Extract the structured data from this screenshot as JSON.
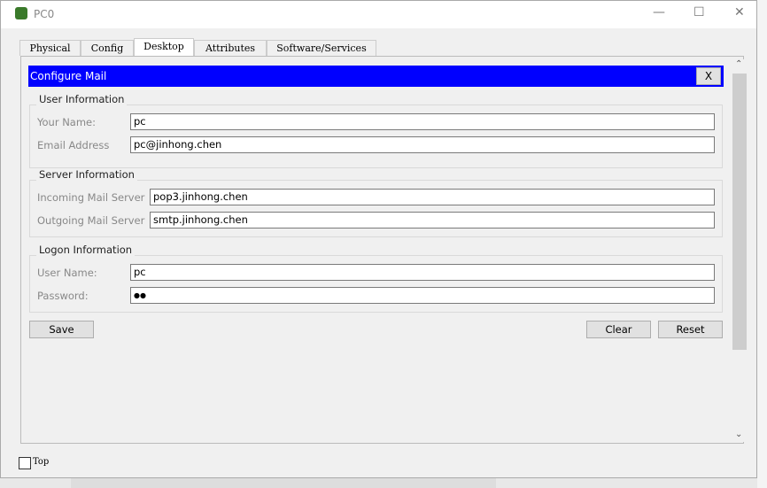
{
  "window": {
    "title": "PC0",
    "minimize": "—",
    "maximize": "☐",
    "close": "✕"
  },
  "tabs": [
    {
      "label": "Physical"
    },
    {
      "label": "Config"
    },
    {
      "label": "Desktop"
    },
    {
      "label": "Attributes"
    },
    {
      "label": "Software/Services"
    }
  ],
  "selected_tab": "Desktop",
  "dialog": {
    "title": "Configure Mail",
    "close_label": "X"
  },
  "user_info": {
    "title": "User Information",
    "name_label": "Your Name:",
    "name_value": "pc",
    "email_label": "Email Address",
    "email_value": "pc@jinhong.chen"
  },
  "server_info": {
    "title": "Server Information",
    "incoming_label": "Incoming Mail Server",
    "incoming_value": "pop3.jinhong.chen",
    "outgoing_label": "Outgoing Mail Server",
    "outgoing_value": "smtp.jinhong.chen"
  },
  "logon_info": {
    "title": "Logon Information",
    "user_label": "User Name:",
    "user_value": "pc",
    "password_label": "Password:",
    "password_value": "●●"
  },
  "buttons": {
    "save": "Save",
    "clear": "Clear",
    "reset": "Reset"
  },
  "footer": {
    "top_label": "Top",
    "top_checked": false
  },
  "colors": {
    "header": "#0000ff"
  }
}
